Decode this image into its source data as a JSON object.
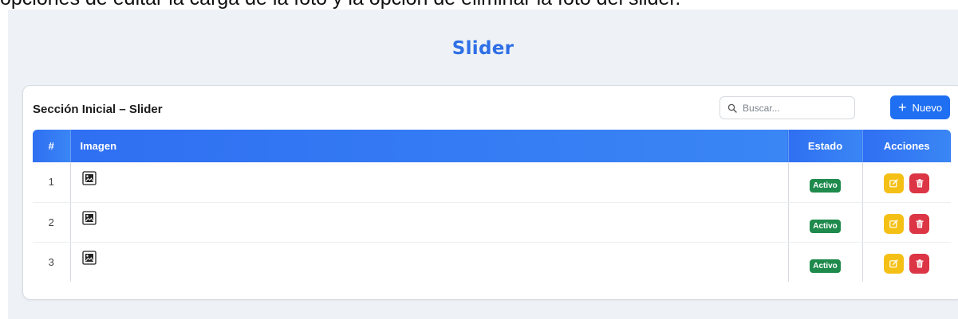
{
  "caption": "opciones de editar la carga de la foto y la opción de eliminar la foto del slider.",
  "page": {
    "title": "Slider",
    "title_color": "#2f6fe6",
    "background": "#eef2f6"
  },
  "card": {
    "title": "Sección Inicial – Slider",
    "search": {
      "placeholder": "Buscar...",
      "value": "",
      "icon": "search-icon"
    },
    "new_button": {
      "icon": "plus-icon",
      "label": "Nuevo",
      "color": "#1f6ff2"
    }
  },
  "table": {
    "headers": {
      "num": "#",
      "image": "Imagen",
      "status": "Estado",
      "actions": "Acciones"
    },
    "header_color": "#2f6ff2",
    "rows": [
      {
        "num": "1",
        "image_icon": "image-icon",
        "status": "Activo"
      },
      {
        "num": "2",
        "image_icon": "image-icon",
        "status": "Activo"
      },
      {
        "num": "3",
        "image_icon": "image-icon",
        "status": "Activo"
      }
    ],
    "status_color": "#1e8a4c",
    "edit_color": "#f5c015",
    "delete_color": "#dc3545",
    "row_actions": [
      "edit-icon",
      "trash-icon"
    ]
  }
}
